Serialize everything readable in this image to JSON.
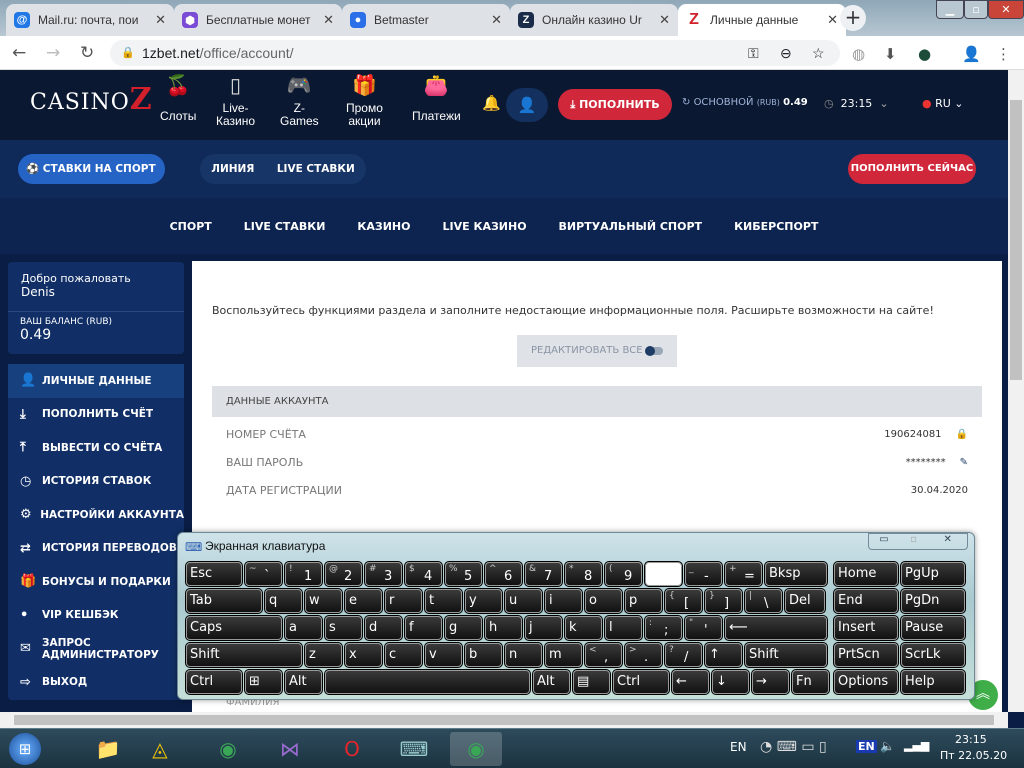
{
  "browser": {
    "tabs": [
      {
        "title": "Mail.ru: почта, пои",
        "icon": "mailru-icon",
        "color": "#1f78e6",
        "glyph": "@"
      },
      {
        "title": "Бесплатные монет",
        "icon": "hexagon-icon",
        "color": "#7a4cd6",
        "glyph": "⬢"
      },
      {
        "title": "Betmaster",
        "icon": "betmaster-icon",
        "color": "#2a6ee8",
        "glyph": "●"
      },
      {
        "title": "Онлайн казино Ur",
        "icon": "casino-icon",
        "color": "#1b2b4a",
        "glyph": "Z"
      },
      {
        "title": "Личные данные",
        "icon": "casinoz-icon",
        "color": "#ffffff",
        "glyph": "Z"
      }
    ],
    "url_host": "1zbet.net",
    "url_path": "/office/account/"
  },
  "site": {
    "logo": "CasinoZ",
    "logo_a": "CASINO",
    "logo_b": "Z",
    "menu": [
      {
        "label": "Слоты",
        "glyph": "🍒"
      },
      {
        "label": "Live-\nКазино",
        "glyph": "▯"
      },
      {
        "label": "Z-\nGames",
        "glyph": "🎮"
      },
      {
        "label": "Промо\nакции",
        "glyph": "🎁"
      },
      {
        "label": "Платежи",
        "glyph": "👛"
      }
    ],
    "deposit": "ПОПОЛНИТЬ",
    "balance_label": "ОСНОВНОЙ",
    "balance_cur": "(RUB)",
    "balance": "0.49",
    "time": "23:15",
    "lang": "RU",
    "sport_bets": "СТАВКИ НА СПОРТ",
    "line": "ЛИНИЯ",
    "live_bets": "LIVE СТАВКИ",
    "deposit_now": "ПОПОЛНИТЬ СЕЙЧАС",
    "nav": [
      "СПОРТ",
      "LIVE СТАВКИ",
      "КАЗИНО",
      "LIVE КАЗИНО",
      "ВИРТУАЛЬНЫЙ СПОРТ",
      "КИБЕРСПОРТ"
    ]
  },
  "sidebar": {
    "welcome": "Добро пожаловать",
    "user": "Denis",
    "balance_label": "ВАШ БАЛАНС (RUB)",
    "balance": "0.49",
    "items": [
      {
        "label": "ЛИЧНЫЕ ДАННЫЕ",
        "glyph": "👤"
      },
      {
        "label": "ПОПОЛНИТЬ СЧЁТ",
        "glyph": "⤓"
      },
      {
        "label": "ВЫВЕСТИ СО СЧЁТА",
        "glyph": "⤒"
      },
      {
        "label": "ИСТОРИЯ СТАВОК",
        "glyph": "◷"
      },
      {
        "label": "НАСТРОЙКИ АККАУНТА",
        "glyph": "⚙"
      },
      {
        "label": "ИСТОРИЯ ПЕРЕВОДОВ",
        "glyph": "⇄"
      },
      {
        "label": "БОНУСЫ И ПОДАРКИ",
        "glyph": "🎁"
      },
      {
        "label": "VIP КЕШБЭК",
        "glyph": "•"
      },
      {
        "label": "ЗАПРОС\nАДМИНИСТРАТОРУ",
        "glyph": "✉"
      },
      {
        "label": "ВЫХОД",
        "glyph": "⇨"
      }
    ]
  },
  "content": {
    "notice": "Воспользуйтесь функциями раздела и заполните недостающие информационные поля. Расширьте возможности на сайте!",
    "edit_all": "РЕДАКТИРОВАТЬ ВСЕ",
    "section": "ДАННЫЕ АККАУНТА",
    "rows": [
      {
        "label": "НОМЕР СЧЁТА",
        "value": "190624081"
      },
      {
        "label": "ВАШ ПАРОЛЬ",
        "value": "********"
      },
      {
        "label": "ДАТА РЕГИСТРАЦИИ",
        "value": "30.04.2020"
      }
    ],
    "surname": "ФАМИЛИЯ"
  },
  "keyboard": {
    "title": "Экранная клавиатура",
    "rows": [
      [
        [
          "Esc"
        ],
        [
          "` ",
          "~"
        ],
        [
          "1",
          "!"
        ],
        [
          "2",
          "@"
        ],
        [
          "3",
          "#"
        ],
        [
          "4",
          "$"
        ],
        [
          "5",
          "%"
        ],
        [
          "6",
          "^"
        ],
        [
          "7",
          "&"
        ],
        [
          "8",
          "*"
        ],
        [
          "9",
          "("
        ],
        [
          ""
        ],
        [
          "-",
          "_"
        ],
        [
          "=",
          "+"
        ],
        [
          "Bksp"
        ]
      ],
      [
        [
          "Tab"
        ],
        [
          "q"
        ],
        [
          "w"
        ],
        [
          "e"
        ],
        [
          "r"
        ],
        [
          "t"
        ],
        [
          "y"
        ],
        [
          "u"
        ],
        [
          "i"
        ],
        [
          "o"
        ],
        [
          "p"
        ],
        [
          "[",
          "{"
        ],
        [
          "]",
          "}"
        ],
        [
          "\\",
          "|"
        ],
        [
          "Del"
        ]
      ],
      [
        [
          "Caps"
        ],
        [
          "a"
        ],
        [
          "s"
        ],
        [
          "d"
        ],
        [
          "f"
        ],
        [
          "g"
        ],
        [
          "h"
        ],
        [
          "j"
        ],
        [
          "k"
        ],
        [
          "l"
        ],
        [
          ";",
          ":"
        ],
        [
          "'",
          "\""
        ],
        [
          "⟵"
        ]
      ],
      [
        [
          "Shift"
        ],
        [
          "z"
        ],
        [
          "x"
        ],
        [
          "c"
        ],
        [
          "v"
        ],
        [
          "b"
        ],
        [
          "n"
        ],
        [
          "m"
        ],
        [
          ",",
          "<"
        ],
        [
          ".",
          ">"
        ],
        [
          "/",
          "?"
        ],
        [
          "↑"
        ],
        [
          "Shift"
        ]
      ],
      [
        [
          "Ctrl"
        ],
        [
          "⊞"
        ],
        [
          "Alt"
        ],
        [
          ""
        ],
        [
          "Alt"
        ],
        [
          "▤"
        ],
        [
          "Ctrl"
        ],
        [
          "←"
        ],
        [
          "↓"
        ],
        [
          "→"
        ],
        [
          "Fn"
        ]
      ]
    ],
    "side": [
      [
        "Home",
        "PgUp"
      ],
      [
        "End",
        "PgDn"
      ],
      [
        "Insert",
        "Pause"
      ],
      [
        "PrtScn",
        "ScrLk"
      ],
      [
        "Options",
        "Help"
      ]
    ]
  },
  "taskbar": {
    "lang": "EN",
    "lang_badge": "EN",
    "time": "23:15",
    "date": "Пт 22.05.20"
  }
}
